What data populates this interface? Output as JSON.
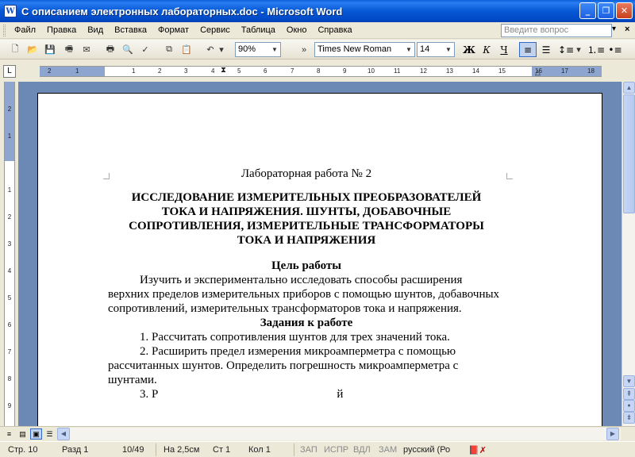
{
  "window": {
    "title": "С описанием электронных лабораторных.doc - Microsoft Word",
    "app_icon": "W"
  },
  "menu": {
    "items": [
      "Файл",
      "Правка",
      "Вид",
      "Вставка",
      "Формат",
      "Сервис",
      "Таблица",
      "Окно",
      "Справка"
    ],
    "help_placeholder": "Введите вопрос"
  },
  "toolbar": {
    "zoom": "90%",
    "font_name": "Times New Roman",
    "font_size": "14",
    "bold": "Ж",
    "italic": "К",
    "underline": "Ч"
  },
  "ruler": {
    "labels": [
      "2",
      "1",
      "1",
      "2",
      "3",
      "4",
      "5",
      "6",
      "7",
      "8",
      "9",
      "10",
      "11",
      "12",
      "13",
      "14",
      "15",
      "16",
      "17",
      "18"
    ],
    "vlabels": [
      "2",
      "1",
      "1",
      "2",
      "3",
      "4",
      "5",
      "6",
      "7",
      "8",
      "9"
    ]
  },
  "document": {
    "lab_number": "Лабораторная работа № 2",
    "title_lines": [
      "ИССЛЕДОВАНИЕ ИЗМЕРИТЕЛЬНЫХ ПРЕОБРАЗОВАТЕЛЕЙ",
      "ТОКА И НАПРЯЖЕНИЯ. ШУНТЫ, ДОБАВОЧНЫЕ",
      "СОПРОТИВЛЕНИЯ, ИЗМЕРИТЕЛЬНЫЕ ТРАНСФОРМАТОРЫ",
      "ТОКА И НАПРЯЖЕНИЯ"
    ],
    "goal_heading": "Цель работы",
    "goal_text": "Изучить и экспериментально исследовать способы расширения верхних пределов измерительных приборов с помощью шунтов, добавочных сопротивлений, измерительных трансформаторов тока и напряжения.",
    "tasks_heading": "Задания к работе",
    "task1": "1. Рассчитать сопротивления шунтов для трех значений тока.",
    "task2": "2. Расширить предел измерения микроамперметра с помощью рассчитанных шунтов. Определить погрешность микроамперметра с шунтами.",
    "task3_partial": "3. Р                                                            й"
  },
  "status": {
    "page": "Стр. 10",
    "section": "Разд 1",
    "pages": "10/49",
    "position": "На 2,5см",
    "line": "Ст 1",
    "column": "Кол 1",
    "rec": "ЗАП",
    "trk": "ИСПР",
    "ext": "ВДЛ",
    "ovr": "ЗАМ",
    "language": "русский (Ро"
  }
}
